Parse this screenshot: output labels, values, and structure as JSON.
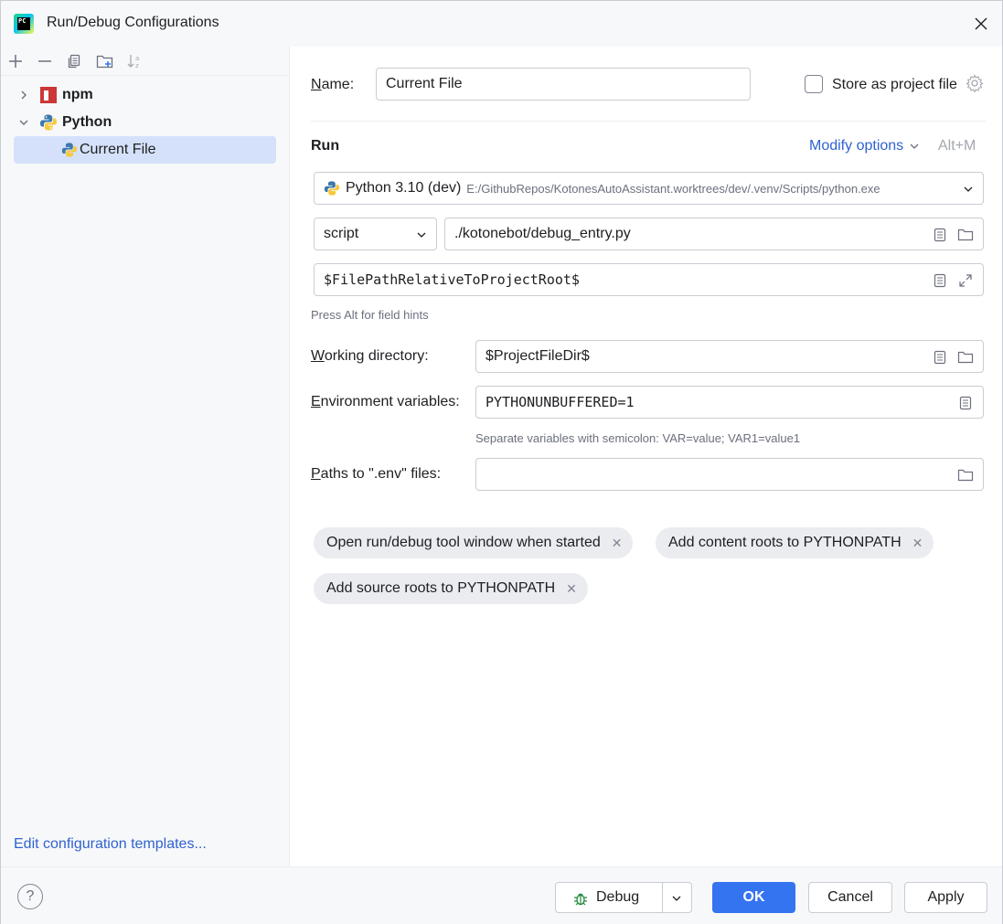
{
  "window": {
    "title": "Run/Debug Configurations",
    "logo_text": "PC"
  },
  "toolbar": {
    "icons": [
      "plus-icon",
      "minus-icon",
      "copy-icon",
      "new-folder-icon",
      "sort-icon"
    ]
  },
  "tree": {
    "items": [
      {
        "label": "npm",
        "icon": "npm-icon",
        "expanded": false
      },
      {
        "label": "Python",
        "icon": "python-icon",
        "expanded": true
      },
      {
        "label": "Current File",
        "icon": "python-file-icon",
        "selected": true
      }
    ]
  },
  "edit_templates_link": "Edit configuration templates...",
  "form": {
    "name_label_ul": "N",
    "name_label_rest": "ame:",
    "name_value": "Current File",
    "store_label": "Store as project file",
    "store_checked": false,
    "run_section": "Run",
    "modify_options": "Modify options",
    "modify_shortcut": "Alt+M",
    "interpreter_name": "Python 3.10 (dev)",
    "interpreter_path": "E:/GithubRepos/KotonesAutoAssistant.worktrees/dev/.venv/Scripts/python.exe",
    "script_type": "script",
    "script_path": "./kotonebot/debug_entry.py",
    "parameters": "$FilePathRelativeToProjectRoot$",
    "field_hint": "Press Alt for field hints",
    "workdir_label_ul": "W",
    "workdir_label_rest": "orking directory:",
    "workdir_value": "$ProjectFileDir$",
    "env_label_ul": "E",
    "env_label_rest": "nvironment variables:",
    "env_value": "PYTHONUNBUFFERED=1",
    "env_hint": "Separate variables with semicolon: VAR=value; VAR1=value1",
    "dotenv_label_ul": "P",
    "dotenv_label_rest": "aths to \".env\" files:",
    "dotenv_value": ""
  },
  "chips": [
    {
      "label": "Open run/debug tool window when started"
    },
    {
      "label": "Add content roots to PYTHONPATH"
    },
    {
      "label": "Add source roots to PYTHONPATH"
    }
  ],
  "footer": {
    "help": "?",
    "debug_label": "Debug",
    "ok_label": "OK",
    "cancel_label": "Cancel",
    "apply_label": "Apply"
  },
  "colors": {
    "accent": "#3574f0",
    "link": "#2f62cf",
    "selection": "#d5e1fa",
    "npm_red": "#cb3837"
  }
}
